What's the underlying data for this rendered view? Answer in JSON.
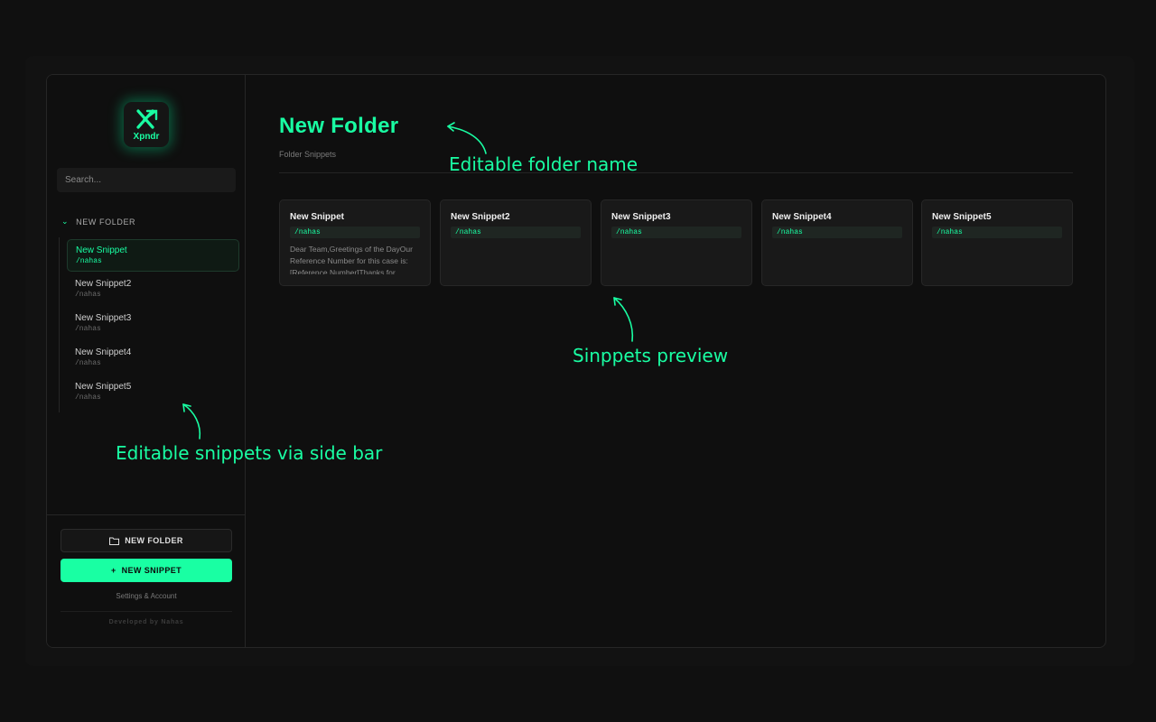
{
  "app": {
    "logo_text": "Xpndr"
  },
  "sidebar": {
    "search_placeholder": "Search...",
    "folder": {
      "label": "NEW FOLDER",
      "expanded": true
    },
    "items": [
      {
        "name": "New Snippet",
        "shortcut": "/nahas",
        "active": true
      },
      {
        "name": "New Snippet2",
        "shortcut": "/nahas",
        "active": false
      },
      {
        "name": "New Snippet3",
        "shortcut": "/nahas",
        "active": false
      },
      {
        "name": "New Snippet4",
        "shortcut": "/nahas",
        "active": false
      },
      {
        "name": "New Snippet5",
        "shortcut": "/nahas",
        "active": false
      }
    ],
    "new_folder_label": "NEW FOLDER",
    "new_snippet_label": "NEW SNIPPET",
    "settings_label": "Settings & Account",
    "developer_credit": "Developed by Nahas"
  },
  "main": {
    "folder_title": "New Folder",
    "folder_subtitle": "Folder Snippets",
    "cards": [
      {
        "name": "New Snippet",
        "shortcut": "/nahas",
        "preview": "Dear Team,Greetings of the DayOur Reference Number for this case is: [Reference Number]Thanks for"
      },
      {
        "name": "New Snippet2",
        "shortcut": "/nahas",
        "preview": ""
      },
      {
        "name": "New Snippet3",
        "shortcut": "/nahas",
        "preview": ""
      },
      {
        "name": "New Snippet4",
        "shortcut": "/nahas",
        "preview": ""
      },
      {
        "name": "New Snippet5",
        "shortcut": "/nahas",
        "preview": ""
      }
    ]
  },
  "annotations": {
    "folder_name": "Editable folder name",
    "preview": "Sinppets preview",
    "sidebar": "Editable snippets via side bar"
  },
  "colors": {
    "accent": "#19ffa3",
    "background": "#101010",
    "panel": "#0f0f0f",
    "card": "#191919"
  },
  "icons": {
    "folder_chevron": "chevron-down-icon",
    "new_folder": "folder-icon",
    "new_snippet": "plus-icon"
  }
}
